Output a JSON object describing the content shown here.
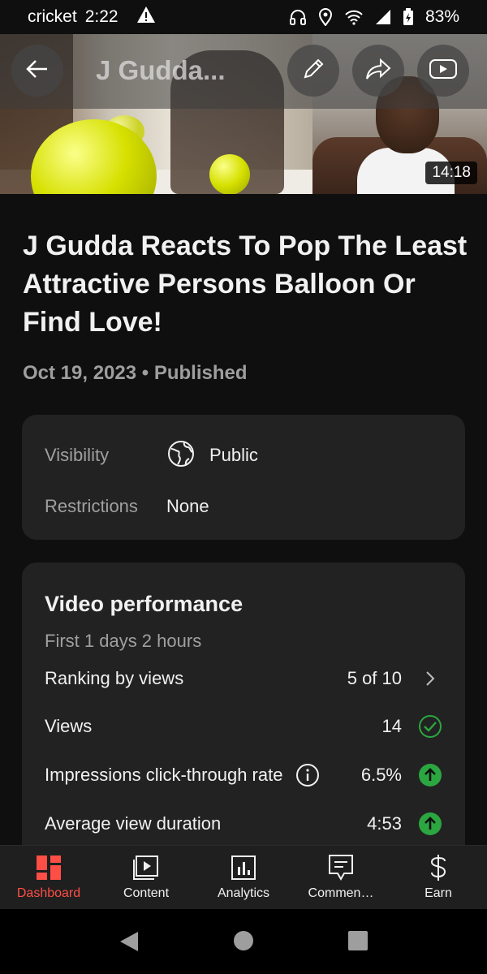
{
  "status_bar": {
    "carrier": "cricket",
    "time": "2:22",
    "battery": "83%"
  },
  "header": {
    "title": "J Gudda...",
    "duration": "14:18"
  },
  "video": {
    "title": "J Gudda Reacts To Pop The Least Attractive Persons Balloon Or Find Love!",
    "meta": "Oct 19, 2023 • Published"
  },
  "details": {
    "visibility_label": "Visibility",
    "visibility_value": "Public",
    "restrictions_label": "Restrictions",
    "restrictions_value": "None"
  },
  "performance": {
    "title": "Video performance",
    "subtitle": "First 1 days 2 hours",
    "rows": [
      {
        "label": "Ranking by views",
        "value": "5 of 10",
        "indicator": "chevron-right-icon"
      },
      {
        "label": "Views",
        "value": "14",
        "indicator": "check-circle-icon"
      },
      {
        "label": "Impressions click-through rate",
        "value": "6.5%",
        "indicator": "arrow-up-circle-icon"
      },
      {
        "label": "Average view duration",
        "value": "4:53",
        "indicator": "arrow-up-circle-icon"
      }
    ]
  },
  "bottom_nav": {
    "items": [
      {
        "label": "Dashboard",
        "icon": "dashboard-icon",
        "active": true
      },
      {
        "label": "Content",
        "icon": "content-icon",
        "active": false
      },
      {
        "label": "Analytics",
        "icon": "analytics-icon",
        "active": false
      },
      {
        "label": "Commen…",
        "icon": "comments-icon",
        "active": false
      },
      {
        "label": "Earn",
        "icon": "dollar-icon",
        "active": false
      }
    ]
  },
  "colors": {
    "background": "#0f0f0f",
    "card": "#222222",
    "accent_red": "#ff4e45",
    "green": "#2ba640",
    "muted_text": "#a0a0a0"
  }
}
